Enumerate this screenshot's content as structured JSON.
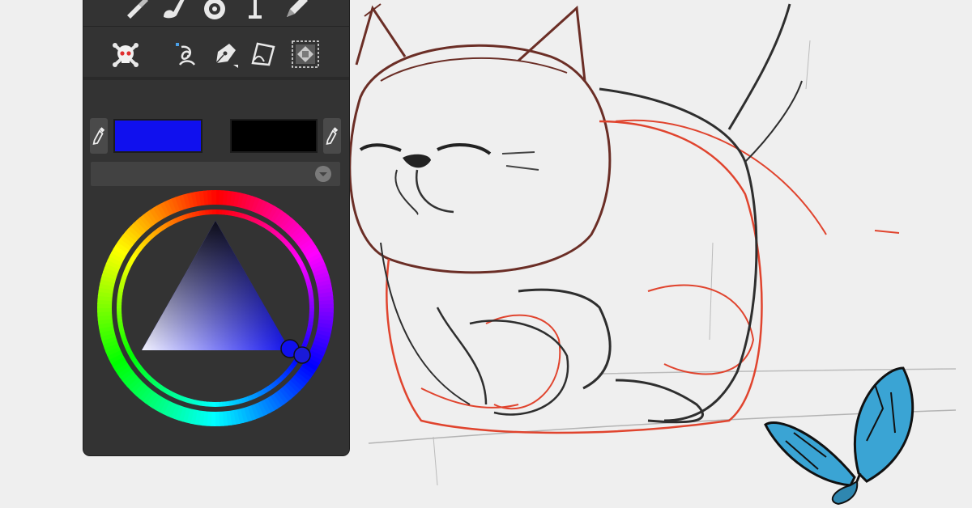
{
  "panel": {
    "tools_row1": [
      {
        "name": "brush-icon"
      },
      {
        "name": "paintbrush-icon"
      },
      {
        "name": "eye-icon"
      },
      {
        "name": "text-tool-icon"
      },
      {
        "name": "pen-icon"
      }
    ],
    "tools_row2": [
      {
        "name": "skull-crossbones-icon"
      },
      {
        "name": "spiral-path-icon"
      },
      {
        "name": "fountain-pen-icon"
      },
      {
        "name": "paper-icon"
      },
      {
        "name": "pattern-fill-icon"
      }
    ],
    "primary_color": "#1010ee",
    "secondary_color": "#000000",
    "color_model": {
      "selected": ""
    },
    "wheel": {
      "hue": "blue",
      "selected_color": "#1010ee"
    }
  },
  "canvas": {
    "subject": "cat-sketch",
    "decoration": "butterfly"
  }
}
